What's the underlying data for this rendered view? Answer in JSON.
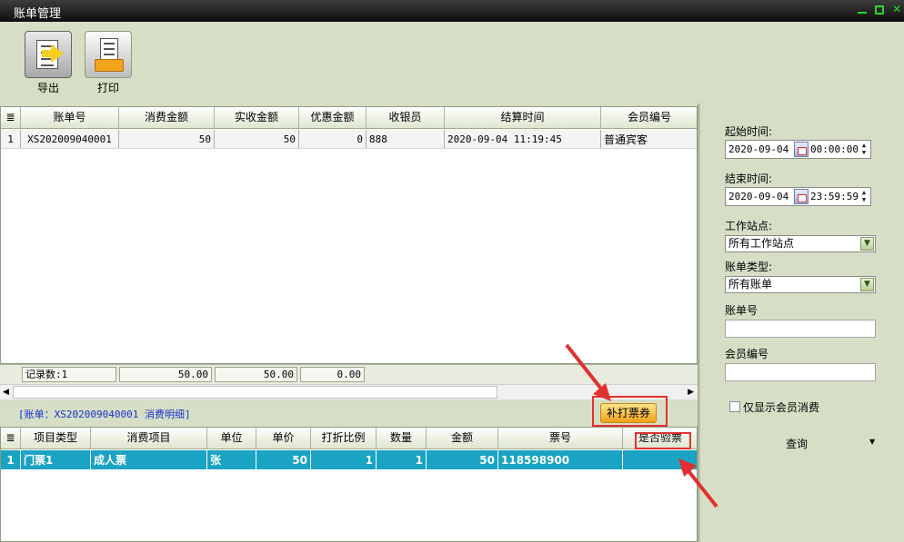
{
  "window": {
    "title": "账单管理"
  },
  "toolbar": {
    "export_label": "导出",
    "print_label": "打印"
  },
  "bills_table": {
    "columns": [
      "账单号",
      "消费金额",
      "实收金额",
      "优惠金额",
      "收银员",
      "结算时间",
      "会员编号"
    ],
    "rows": [
      {
        "index": "1",
        "bill_no": "XS202009040001",
        "consume_amount": "50",
        "received_amount": "50",
        "discount_amount": "0",
        "cashier": "888",
        "settle_time": "2020-09-04 11:19:45",
        "member_no": "普通宾客"
      }
    ],
    "summary": {
      "record_count": "记录数:1",
      "consume_total": "50.00",
      "received_total": "50.00",
      "discount_total": "0.00"
    }
  },
  "detail": {
    "label": "[账单：XS202009040001 消费明细]",
    "reprint_button": "补打票券",
    "columns": [
      "项目类型",
      "消费项目",
      "单位",
      "单价",
      "打折比例",
      "数量",
      "金额",
      "票号",
      "是否验票"
    ],
    "rows": [
      {
        "index": "1",
        "item_type": "门票1",
        "item": "成人票",
        "unit": "张",
        "unit_price": "50",
        "discount_ratio": "1",
        "quantity": "1",
        "amount": "50",
        "ticket_no": "118598900",
        "verified": ""
      }
    ]
  },
  "filters": {
    "start_label": "起始时间:",
    "start_date": "2020-09-04",
    "start_time": "00:00:00",
    "end_label": "结束时间:",
    "end_date": "2020-09-04",
    "end_time": "23:59:59",
    "station_label": "工作站点:",
    "station_value": "所有工作站点",
    "bill_type_label": "账单类型:",
    "bill_type_value": "所有账单",
    "bill_no_label": "账单号",
    "bill_no_value": "",
    "member_no_label": "会员编号",
    "member_no_value": "",
    "member_only_label": "仅显示会员消费",
    "query_label": "查询"
  },
  "colors": {
    "accent_selection": "#1aa3c3",
    "highlight": "#e23030",
    "panel_bg": "#d6dfc6"
  }
}
